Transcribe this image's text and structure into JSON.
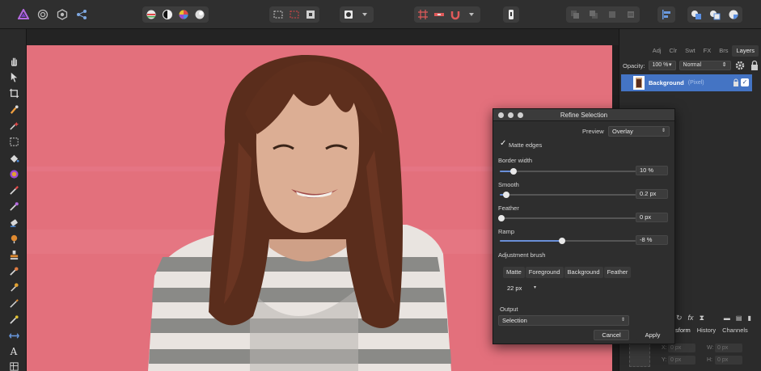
{
  "toolbar": {
    "personas": [
      "affinity-photo-icon",
      "liquify-persona-icon",
      "develop-persona-icon",
      "export-persona-icon"
    ],
    "colors": {
      "accent": "#4474c4",
      "canvas": "#e3707c"
    }
  },
  "layers_panel": {
    "tabs": [
      "Adj",
      "Clr",
      "Swt",
      "FX",
      "Brs",
      "Layers"
    ],
    "active_tab": "Layers",
    "opacity_label": "Opacity:",
    "opacity_value": "100 %",
    "blend_mode": "Normal",
    "layer": {
      "name": "Background",
      "type": "(Pixel)"
    }
  },
  "bottom_panel": {
    "tabs": [
      "sform",
      "History",
      "Channels"
    ],
    "fields": {
      "x": "X:",
      "x_val": "0 px",
      "w": "W:",
      "w_val": "0 px",
      "y": "Y:",
      "y_val": "0 px",
      "h": "H:",
      "h_val": "0 px"
    }
  },
  "refine_dialog": {
    "title": "Refine Selection",
    "preview_label": "Preview",
    "preview_value": "Overlay",
    "matte_edges_label": "Matte edges",
    "matte_edges_checked": true,
    "border_width": {
      "label": "Border width",
      "value": "10 %",
      "level": 0.1
    },
    "smooth": {
      "label": "Smooth",
      "value": "0.2 px",
      "level": 0.05
    },
    "feather": {
      "label": "Feather",
      "value": "0 px",
      "level": 0.0
    },
    "ramp": {
      "label": "Ramp",
      "value": "-8 %",
      "level": 0.46
    },
    "adjustment_brush_label": "Adjustment brush",
    "brush_modes": [
      "Matte",
      "Foreground",
      "Background",
      "Feather"
    ],
    "brush_size": "22 px",
    "output_label": "Output",
    "output_value": "Selection",
    "cancel_label": "Cancel",
    "apply_label": "Apply"
  }
}
